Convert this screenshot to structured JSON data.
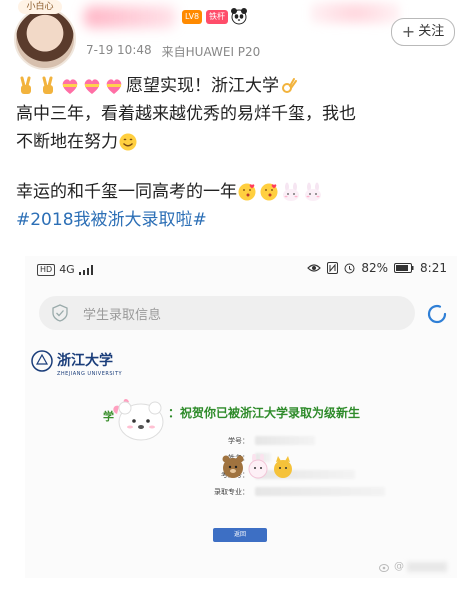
{
  "post": {
    "avatar_badge": "小白心",
    "level_badge": "LV8",
    "fan_badge": "铁杆",
    "follow_label": "关注",
    "timestamp": "7-19 10:48",
    "source": "来自HUAWEI P20",
    "lines": {
      "l1": "愿望实现！浙江大学",
      "l2": "高中三年，看着越来越优秀的易烊千玺，我也",
      "l3": "不断地在努力",
      "l4": "幸运的和千玺一同高考的一年",
      "hashtag": "#2018我被浙大录取啦#"
    }
  },
  "screenshot": {
    "status_left": "4G",
    "battery": "82%",
    "time": "8:21",
    "search_placeholder": "学生录取信息",
    "zju_name_cn": "浙江大学",
    "zju_name_en": "ZHEJIANG UNIVERSITY",
    "congrats_prefix": "学",
    "congrats_text": "：祝贺你已被浙江大学录取为级新生",
    "form_labels": {
      "student_id": "学号：",
      "name": "姓名：",
      "exam_id": "考生号：",
      "major": "录取专业："
    },
    "back_button": "返回"
  },
  "watermark": "@",
  "colors": {
    "hashtag": "#2c6fb6",
    "congrats": "#2e8b2a",
    "zju_blue": "#1a3d7a"
  }
}
